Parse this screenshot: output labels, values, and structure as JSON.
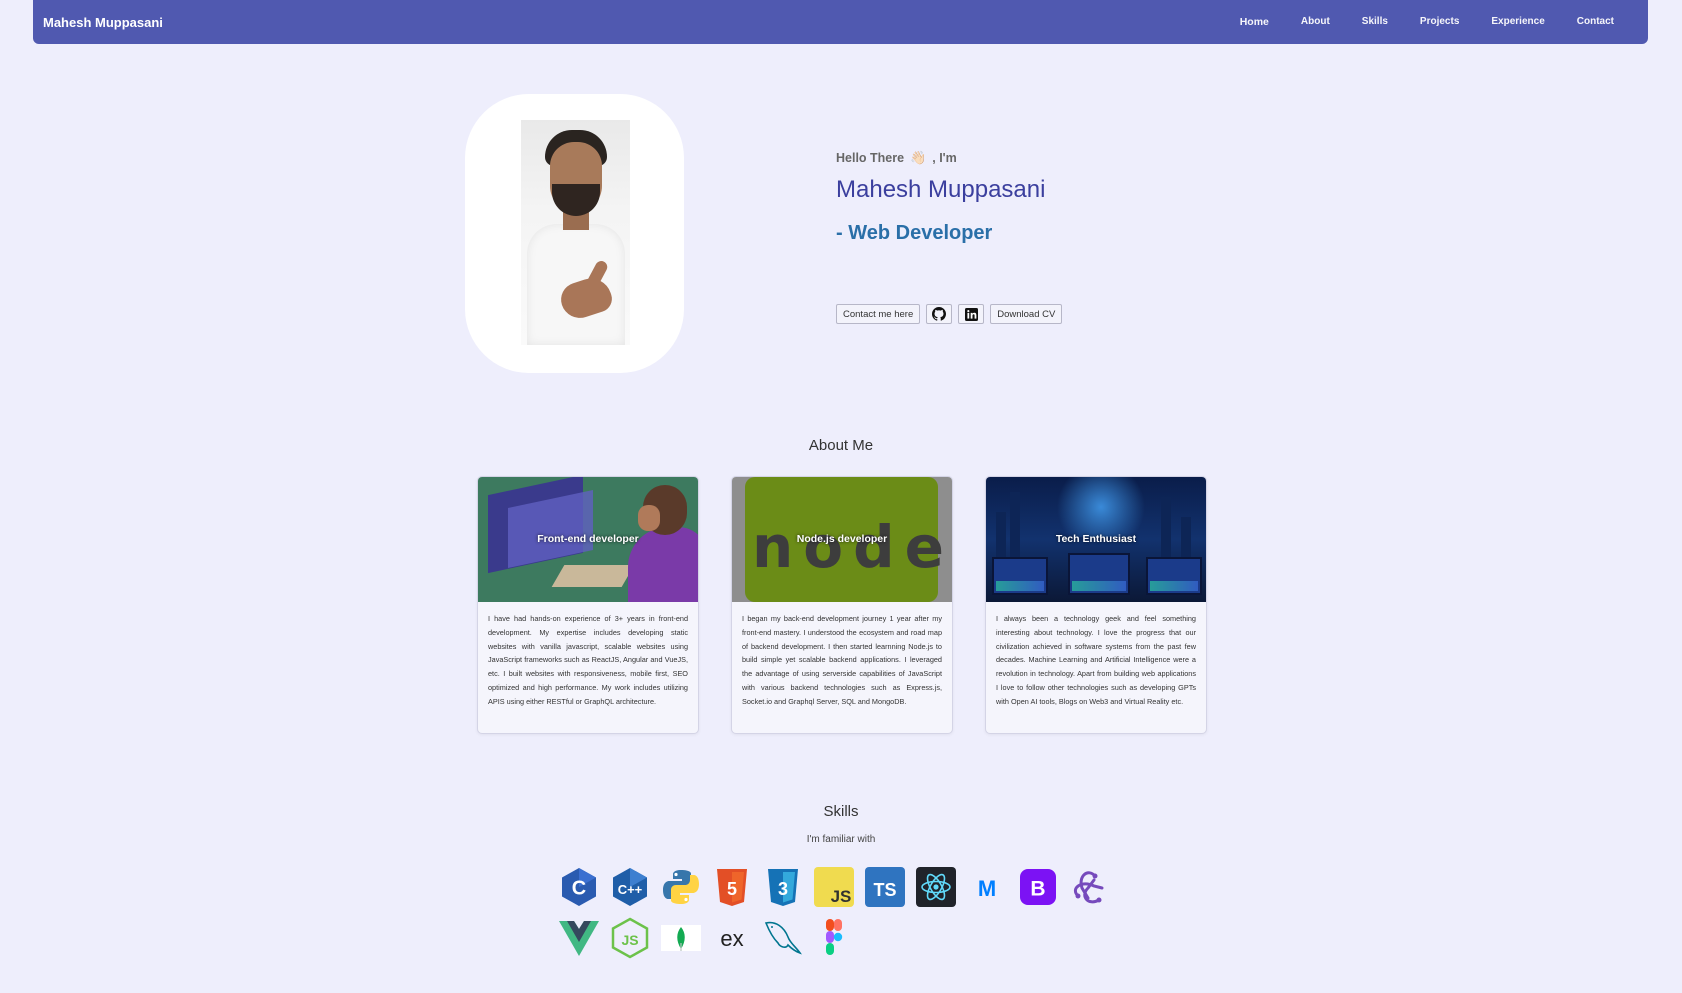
{
  "navbar": {
    "brand": "Mahesh Muppasani",
    "links": [
      "Home",
      "About",
      "Skills",
      "Projects",
      "Experience",
      "Contact"
    ]
  },
  "hero": {
    "greeting": "Hello There",
    "greeting_suffix": ", I'm",
    "wave_emoji": "👋🏻",
    "name": "Mahesh Muppasani",
    "role": "- Web Developer",
    "contact_button": "Contact me here",
    "download_button": "Download CV"
  },
  "about": {
    "title": "About Me",
    "cards": [
      {
        "label": "Front-end developer",
        "text": "I have had hands-on experience of 3+ years in front-end development. My expertise includes developing static websites with vanilla javascript, scalable websites using JavaScript frameworks such as ReactJS, Angular and VueJS, etc. I built websites with responsiveness, mobile first, SEO optimized and high performance. My work includes utilizing APIS using either RESTful or GraphQL architecture."
      },
      {
        "label": "Node.js developer",
        "text": "I began my back-end development journey 1 year after my front-end mastery. I understood the ecosystem and road map of backend development. I then started learnning Node.js to build simple yet scalable backend applications. I leveraged the advantage of using serverside capabilities of JavaScript with various backend technologies such as Express.js, Socket.io and Graphql Server, SQL and MongoDB."
      },
      {
        "label": "Tech Enthusiast",
        "text": "I always been a technology geek and feel something interesting about technology. I love the progress that our civilization achieved in software systems from the past few decades. Machine Learning and Artificial Intelligence were a revolution in technology. Apart from building web applications I love to follow other technologies such as developing GPTs with Open AI tools, Blogs on Web3 and Virtual Reality etc."
      }
    ]
  },
  "skills": {
    "title": "Skills",
    "subtitle": "I'm familiar with",
    "icons_row1": [
      "c-icon",
      "cpp-icon",
      "python-icon",
      "html5-icon",
      "css3-icon",
      "javascript-icon",
      "typescript-icon",
      "react-icon",
      "material-ui-icon",
      "bootstrap-icon",
      "redux-icon"
    ],
    "icons_row2": [
      "vue-icon",
      "nodejs-icon",
      "mongodb-icon",
      "express-icon",
      "mysql-icon",
      "figma-icon"
    ],
    "text_glyphs": {
      "c": "C",
      "cpp": "C++",
      "html": "5",
      "css": "3",
      "js": "JS",
      "ts": "TS",
      "mui": "M",
      "bootstrap": "B",
      "express": "ex"
    }
  },
  "colors": {
    "background": "#eeeefc",
    "navbar": "#5059b0",
    "name": "#3b3f9e",
    "role": "#2a6fa8"
  }
}
